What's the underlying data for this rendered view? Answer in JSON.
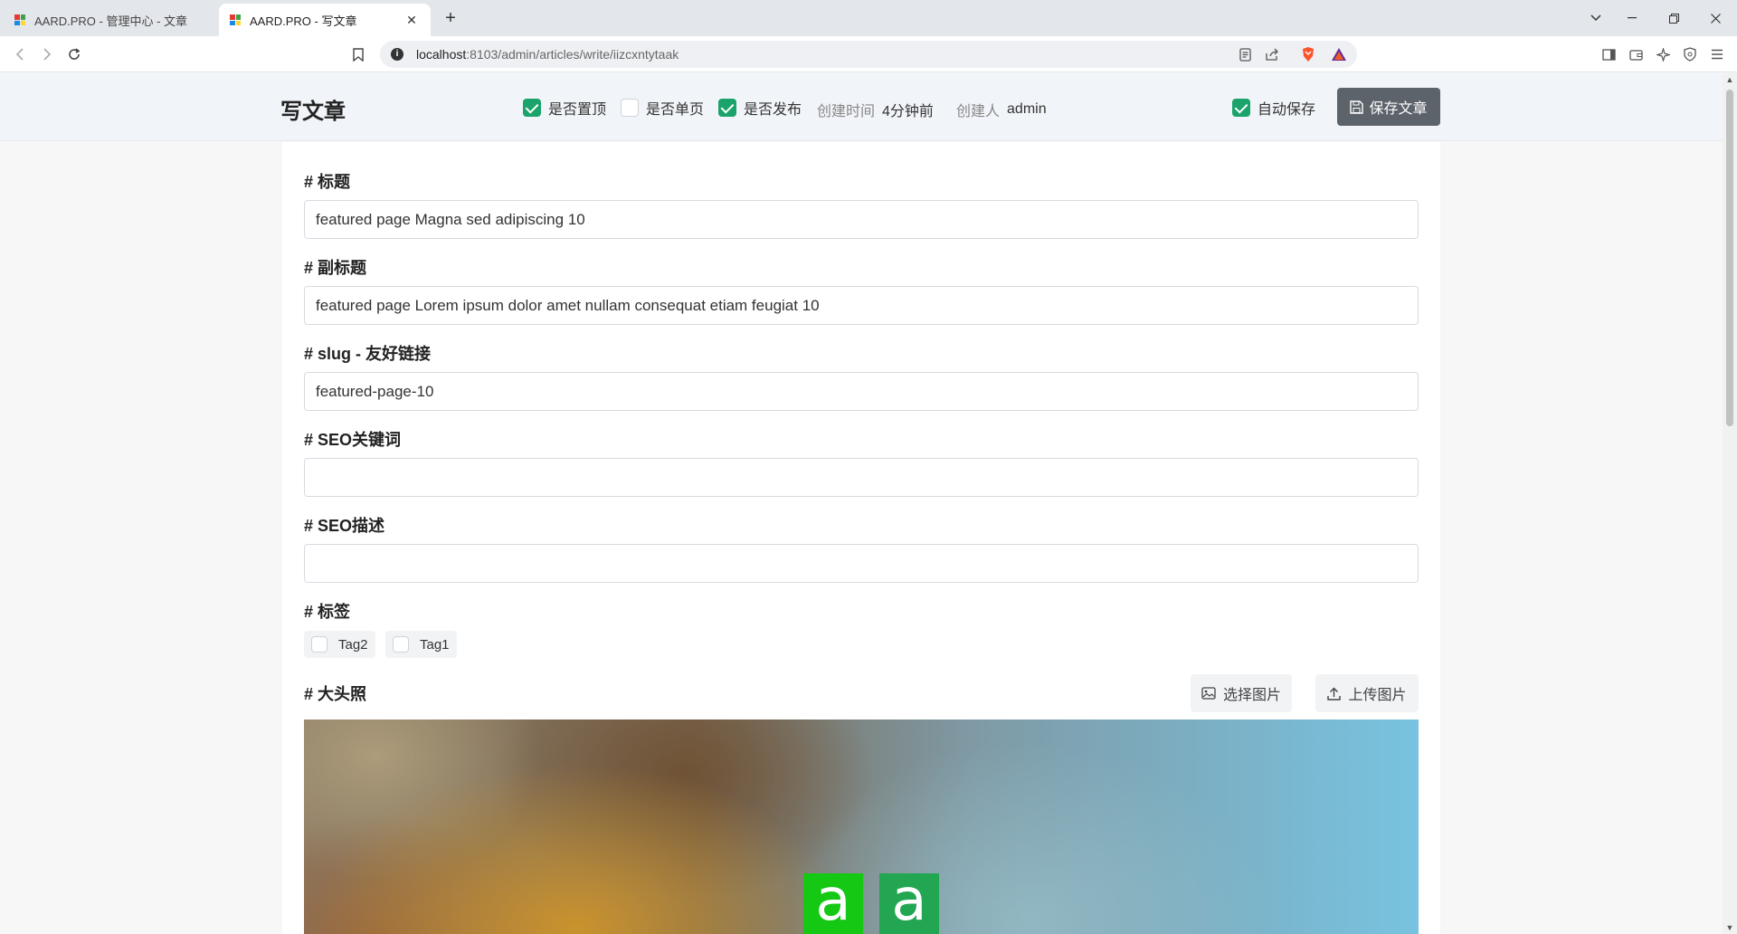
{
  "browser": {
    "tabs": [
      {
        "title": "AARD.PRO - 管理中心 - 文章"
      },
      {
        "title": "AARD.PRO - 写文章"
      }
    ],
    "url_host": "localhost",
    "url_path": ":8103/admin/articles/write/iizcxntytaak"
  },
  "header": {
    "title": "写文章",
    "checks": {
      "pinned": {
        "label": "是否置顶",
        "checked": true
      },
      "single_page": {
        "label": "是否单页",
        "checked": false
      },
      "published": {
        "label": "是否发布",
        "checked": true
      }
    },
    "created_time_label": "创建时间",
    "created_time_value": "4分钟前",
    "creator_label": "创建人",
    "creator_value": "admin",
    "autosave": {
      "label": "自动保存",
      "checked": true
    },
    "save_label": "保存文章"
  },
  "form": {
    "title": {
      "label": "# 标题",
      "value": "featured page Magna sed adipiscing 10"
    },
    "subtitle": {
      "label": "# 副标题",
      "value": "featured page Lorem ipsum dolor amet nullam consequat etiam feugiat 10"
    },
    "slug": {
      "label": "# slug - 友好链接",
      "value": "featured-page-10"
    },
    "seo_keywords": {
      "label": "# SEO关键词",
      "value": ""
    },
    "seo_description": {
      "label": "# SEO描述",
      "value": ""
    },
    "tags": {
      "label": "# 标签",
      "items": [
        {
          "label": "Tag2",
          "checked": false
        },
        {
          "label": "Tag1",
          "checked": false
        }
      ]
    },
    "avatar": {
      "label": "# 大头照",
      "select_label": "选择图片",
      "upload_label": "上传图片",
      "logo_letters": [
        "a",
        "a"
      ]
    }
  },
  "colors": {
    "accent_green": "#1aa36a",
    "save_button": "#5d636b",
    "logo_green_1": "#14c814",
    "logo_green_2": "#22a652"
  }
}
